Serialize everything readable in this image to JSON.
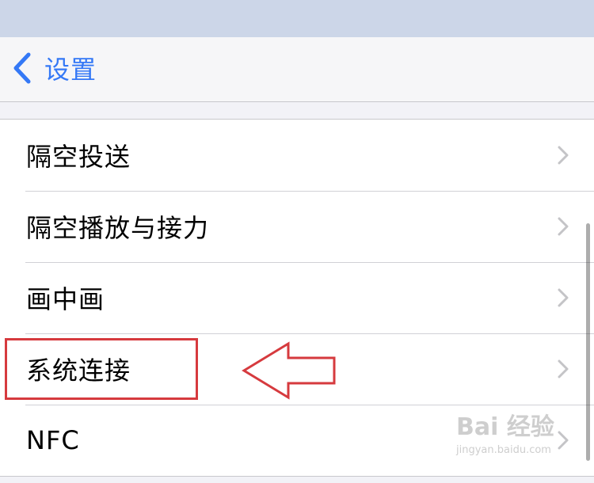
{
  "nav": {
    "back_label": "设置"
  },
  "rows": [
    {
      "label": "隔空投送"
    },
    {
      "label": "隔空播放与接力"
    },
    {
      "label": "画中画"
    },
    {
      "label": "系统连接"
    },
    {
      "label": "NFC"
    }
  ],
  "watermark": {
    "brand": "Bai 经验",
    "url": "jingyan.baidu.com"
  },
  "icons": {
    "back": "chevron-left-icon",
    "disclosure": "chevron-right-icon"
  },
  "colors": {
    "accent": "#3478f6",
    "annotation": "#d63a3e",
    "chevron": "#c4c4c7"
  }
}
